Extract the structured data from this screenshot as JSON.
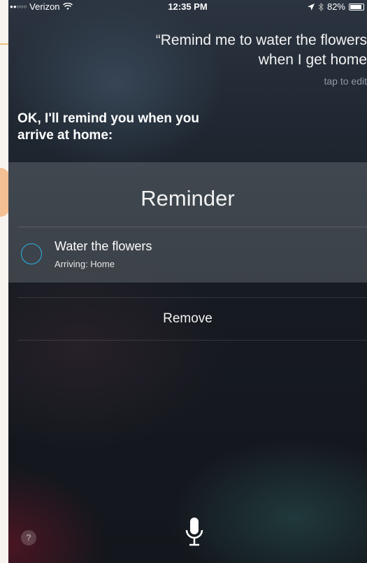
{
  "status_bar": {
    "carrier": "Verizon",
    "time": "12:35 PM",
    "battery": "82%",
    "battery_level": 0.82,
    "signal_icon": "signal-dots-icon",
    "wifi_icon": "wifi-icon",
    "location_icon": "location-arrow-icon",
    "bluetooth_icon": "bluetooth-icon"
  },
  "siri": {
    "query_line1": "“Remind me to water the flowers",
    "query_line2": "when I get home",
    "tap_to_edit": "tap to edit",
    "response_line1": "OK, I'll remind you when you",
    "response_line2": "arrive at home:"
  },
  "reminder_card": {
    "title": "Reminder",
    "item_title": "Water the flowers",
    "item_subtitle": "Arriving: Home",
    "checkbox_color": "#2bb3e6"
  },
  "actions": {
    "remove_label": "Remove"
  },
  "bottom": {
    "help_label": "?",
    "mic_icon": "microphone-icon"
  }
}
